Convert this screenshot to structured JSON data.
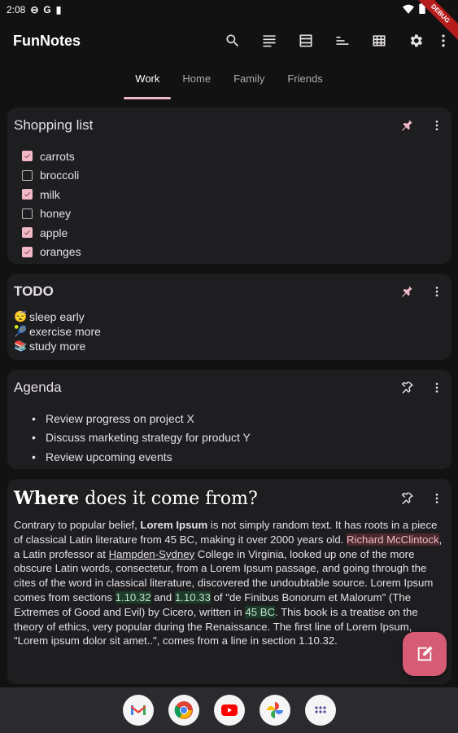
{
  "status_bar": {
    "time": "2:08",
    "icons": [
      "sync-icon",
      "google-icon",
      "sd-card-icon"
    ],
    "right_icons": [
      "wifi-icon",
      "battery-icon"
    ],
    "ribbon": "DEBUG"
  },
  "app_bar": {
    "title": "FunNotes",
    "actions": [
      "search-icon",
      "view-list-icon",
      "view-agenda-icon",
      "sort-icon",
      "grid-icon",
      "settings-icon",
      "more-vert-icon"
    ]
  },
  "tabs": [
    {
      "label": "Work",
      "active": true
    },
    {
      "label": "Home",
      "active": false
    },
    {
      "label": "Family",
      "active": false
    },
    {
      "label": "Friends",
      "active": false
    }
  ],
  "notes": {
    "shopping": {
      "title": "Shopping list",
      "pinned": true,
      "items": [
        {
          "label": "carrots",
          "checked": true
        },
        {
          "label": "broccoli",
          "checked": false
        },
        {
          "label": "milk",
          "checked": true
        },
        {
          "label": "honey",
          "checked": false
        },
        {
          "label": "apple",
          "checked": true
        },
        {
          "label": "oranges",
          "checked": true
        }
      ]
    },
    "todo": {
      "title": "TODO",
      "pinned": true,
      "items": [
        {
          "emoji": "😴",
          "label": "sleep early"
        },
        {
          "emoji": "🎾",
          "label": "exercise more"
        },
        {
          "emoji": "📚",
          "label": "study more"
        }
      ]
    },
    "agenda": {
      "title": "Agenda",
      "pinned": false,
      "bullet": "•",
      "items": [
        "Review progress on project X",
        "Discuss marketing strategy for product Y",
        "Review upcoming events"
      ]
    },
    "article": {
      "title_bold": "Where",
      "title_rest": " does it come from?",
      "pinned": false,
      "body": {
        "p1": "Contrary to popular belief, ",
        "lorem_bold": "Lorem Ipsum",
        "p2": " is not simply random text. It has roots in a piece of classical Latin literature from 45 BC, making it over 2000 years old. ",
        "richard": "Richard McClintock",
        "p3": ", a Latin professor at ",
        "hampden": "Hampden-Sydney",
        "p4": " College in Virginia, looked up one of the more obscure Latin words, consectetur, from a Lorem Ipsum passage, and going through the cites of the word in classical literature, discovered the undoubtable source. Lorem Ipsum comes from sections ",
        "s1": "1.10.32",
        "and": " and ",
        "s2": "1.10.33",
        "p5": " of \"de Finibus Bonorum et Malorum\" (The Extremes of Good and Evil) by Cicero, written in ",
        "bc": "45 BC",
        "p6": ". This book is a treatise on the theory of ethics, very popular during the Renaissance. The first line of Lorem Ipsum, \"Lorem ipsum dolor sit amet..\", comes from a line in section 1.10.32."
      }
    }
  },
  "fab": {
    "icon": "edit-note-icon"
  },
  "dock": [
    "gmail-icon",
    "chrome-icon",
    "youtube-icon",
    "photos-icon",
    "app-drawer-icon"
  ],
  "colors": {
    "accent": "#f2b8c6",
    "fab": "#d65c76",
    "surface": "#1e1d20",
    "background": "#121212"
  }
}
